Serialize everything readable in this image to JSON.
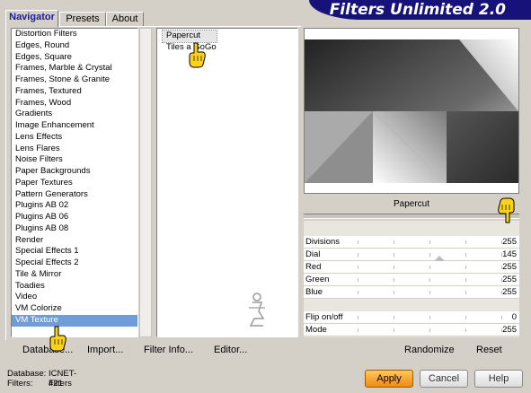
{
  "app": {
    "title": "Filters Unlimited 2.0"
  },
  "tabs": [
    {
      "label": "Navigator",
      "active": true
    },
    {
      "label": "Presets",
      "active": false
    },
    {
      "label": "About",
      "active": false
    }
  ],
  "categories": [
    "Distortion Filters",
    "Edges, Round",
    "Edges, Square",
    "Frames, Marble & Crystal",
    "Frames, Stone & Granite",
    "Frames, Textured",
    "Frames, Wood",
    "Gradients",
    "Image Enhancement",
    "Lens Effects",
    "Lens Flares",
    "Noise Filters",
    "Paper Backgrounds",
    "Paper Textures",
    "Pattern Generators",
    "Plugins AB 02",
    "Plugins AB 06",
    "Plugins AB 08",
    "Render",
    "Special Effects 1",
    "Special Effects 2",
    "Tile & Mirror",
    "Toadies",
    "Video",
    "VM Colorize",
    "VM Texture"
  ],
  "selected_category": "VM Texture",
  "filters": [
    "Papercut",
    "Tiles a GoGo"
  ],
  "selected_filter": "Papercut",
  "preview": {
    "caption": "Papercut"
  },
  "params": [
    {
      "name": "Divisions",
      "value": "255",
      "fraction": 1.0
    },
    {
      "name": "Dial",
      "value": "145",
      "fraction": 0.57
    },
    {
      "name": "Red",
      "value": "255",
      "fraction": 1.0
    },
    {
      "name": "Green",
      "value": "255",
      "fraction": 1.0
    },
    {
      "name": "Blue",
      "value": "255",
      "fraction": 1.0
    },
    {
      "name": "Flip on/off",
      "value": "0",
      "fraction": 0.0
    },
    {
      "name": "Mode",
      "value": "255",
      "fraction": 1.0
    }
  ],
  "toolbar": {
    "database": "Database...",
    "import": "Import...",
    "filter_info": "Filter Info...",
    "editor": "Editor...",
    "randomize": "Randomize",
    "reset": "Reset"
  },
  "status": {
    "database_label": "Database:",
    "database_value": "ICNET-Filters",
    "filters_label": "Filters:",
    "filters_value": "421"
  },
  "buttons": {
    "apply": "Apply",
    "cancel": "Cancel",
    "help": "Help"
  },
  "colors": {
    "banner": "#16127a",
    "selection": "#6e9dd8",
    "apply": "#f08a10"
  }
}
